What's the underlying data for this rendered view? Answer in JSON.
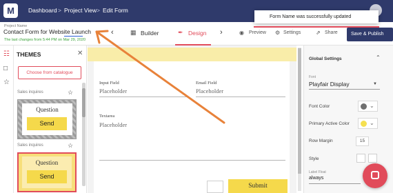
{
  "topnav": {
    "breadcrumbs": [
      "Dashboard",
      "Project View",
      "Edit Form"
    ],
    "separator": ">"
  },
  "header": {
    "project_label": "Project Name",
    "project_name": "Contact Form for Website Launch",
    "last_changes": "The last changes from 5:44 PM on Mar 29, 2020",
    "tabs": [
      {
        "label": "Builder",
        "icon": "grid-icon"
      },
      {
        "label": "Design",
        "icon": "brush-icon",
        "active": true
      }
    ],
    "tools": [
      {
        "label": "Preview",
        "icon": "eye-icon"
      },
      {
        "label": "Settings",
        "icon": "gear-icon"
      },
      {
        "label": "Share",
        "icon": "share-icon"
      }
    ],
    "save_button": "Save & Publish"
  },
  "toast": {
    "message": "Form Name was successfully updated"
  },
  "themes": {
    "title": "THEMES",
    "catalogue_button": "Choose from catalogue",
    "cards": [
      {
        "name": "Sales inquires",
        "question": "Question",
        "send": "Send"
      },
      {
        "name": "Sales inquires",
        "question": "Question",
        "send": "Send"
      }
    ]
  },
  "form": {
    "fields": [
      {
        "label": "Input Field",
        "placeholder": "Placeholder"
      },
      {
        "label": "Email Field",
        "placeholder": "Placeholder"
      },
      {
        "label": "Textarea",
        "placeholder": "Placeholder"
      }
    ],
    "submit": "Submit"
  },
  "settings": {
    "title": "Global Settings",
    "font_label": "Font",
    "font_value": "Playfair Display",
    "font_color_label": "Font Color",
    "primary_color_label": "Primary Active Color",
    "row_margin_label": "Row Margin",
    "row_margin_value": "15",
    "style_label": "Style",
    "label_float_label": "Label Float",
    "label_float_value": "always"
  },
  "colors": {
    "nav": "#2f3a6b",
    "accent": "#e14b5a",
    "theme_yellow": "#f5d94b",
    "font_color_swatch": "#707070",
    "primary_color_swatch": "#f5e050",
    "success_text": "#3aa23a",
    "annotation_arrow": "#e8823a"
  }
}
